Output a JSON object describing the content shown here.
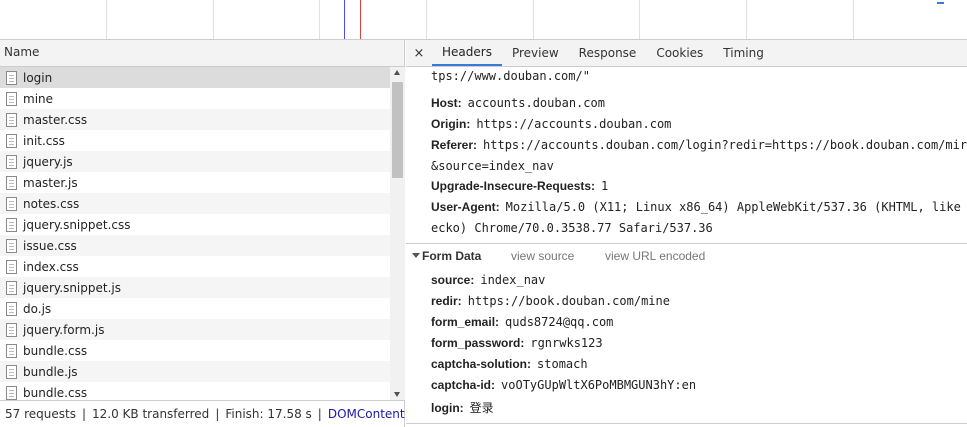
{
  "list": {
    "header": "Name",
    "items": [
      "login",
      "mine",
      "master.css",
      "init.css",
      "jquery.js",
      "master.js",
      "notes.css",
      "jquery.snippet.css",
      "issue.css",
      "index.css",
      "jquery.snippet.js",
      "do.js",
      "jquery.form.js",
      "bundle.css",
      "bundle.js",
      "bundle.css"
    ]
  },
  "status": {
    "requests": "57 requests",
    "transferred": "12.0 KB transferred",
    "finish": "Finish: 17.58 s",
    "domcontent": "DOMContentL...",
    "separator": "|"
  },
  "tabs": {
    "close": "×",
    "items": [
      "Headers",
      "Preview",
      "Response",
      "Cookies",
      "Timing"
    ]
  },
  "headers": {
    "partial_top": "tps://www.douban.com/\"",
    "host_key": "Host:",
    "host_val": "accounts.douban.com",
    "origin_key": "Origin:",
    "origin_val": "https://accounts.douban.com",
    "referer_key": "Referer:",
    "referer_val": "https://accounts.douban.com/login?redir=https://book.douban.com/mir",
    "referer_cont": "&source=index_nav",
    "uir_key": "Upgrade-Insecure-Requests:",
    "uir_val": "1",
    "ua_key": "User-Agent:",
    "ua_val": "Mozilla/5.0 (X11; Linux x86_64) AppleWebKit/537.36 (KHTML, like",
    "ua_cont": "ecko) Chrome/70.0.3538.77 Safari/537.36"
  },
  "form_data": {
    "title": "Form Data",
    "view_source": "view source",
    "view_url_encoded": "view URL encoded",
    "fields": [
      {
        "key": "source:",
        "value": "index_nav"
      },
      {
        "key": "redir:",
        "value": "https://book.douban.com/mine"
      },
      {
        "key": "form_email:",
        "value": "quds8724@qq.com"
      },
      {
        "key": "form_password:",
        "value": "rgnrwks123"
      },
      {
        "key": "captcha-solution:",
        "value": "stomach"
      },
      {
        "key": "captcha-id:",
        "value": "voOTyGUpWltX6PoMBMGUN3hY:en"
      },
      {
        "key": "login:",
        "value": "登录"
      }
    ]
  },
  "colors": {
    "accent": "#3879d9",
    "dom_content_link": "#1a1aa6",
    "overview_blue": "#4a4af0",
    "overview_red": "#e04040"
  }
}
